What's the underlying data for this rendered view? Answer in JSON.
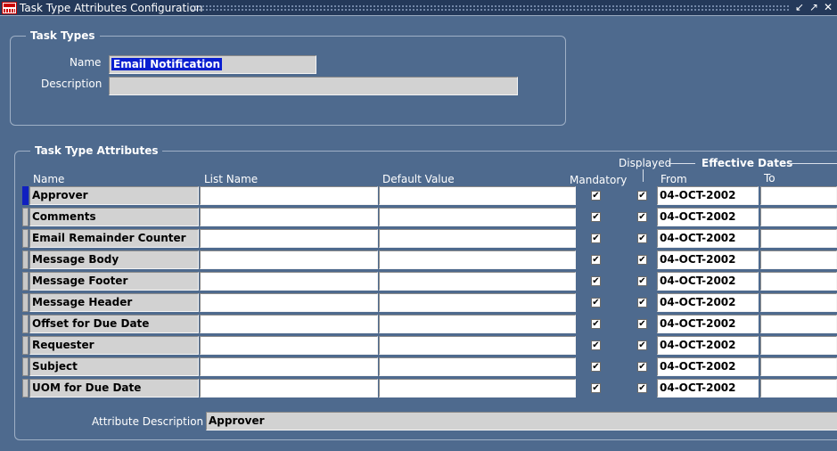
{
  "window": {
    "title": "Task Type Attributes Configuration",
    "buttons": [
      "↙",
      "↗",
      "✕"
    ]
  },
  "task_types": {
    "group_title": "Task Types",
    "name_label": "Name",
    "name_value": "Email Notification",
    "description_label": "Description",
    "description_value": ""
  },
  "attributes": {
    "group_title": "Task Type Attributes",
    "headers": {
      "name": "Name",
      "list_name": "List Name",
      "default_value": "Default Value",
      "mandatory": "Mandatory",
      "displayed": "Displayed",
      "effective_dates": "Effective Dates",
      "from": "From",
      "to": "To"
    },
    "rows": [
      {
        "name": "Approver",
        "list_name": "",
        "default_value": "",
        "mandatory": "✔",
        "displayed": "✔",
        "from": "04-OCT-2002",
        "to": ""
      },
      {
        "name": "Comments",
        "list_name": "",
        "default_value": "",
        "mandatory": "✔",
        "displayed": "✔",
        "from": "04-OCT-2002",
        "to": ""
      },
      {
        "name": "Email Remainder Counter",
        "list_name": "",
        "default_value": "",
        "mandatory": "✔",
        "displayed": "✔",
        "from": "04-OCT-2002",
        "to": ""
      },
      {
        "name": "Message Body",
        "list_name": "",
        "default_value": "",
        "mandatory": "✔",
        "displayed": "✔",
        "from": "04-OCT-2002",
        "to": ""
      },
      {
        "name": "Message Footer",
        "list_name": "",
        "default_value": "",
        "mandatory": "✔",
        "displayed": "✔",
        "from": "04-OCT-2002",
        "to": ""
      },
      {
        "name": "Message Header",
        "list_name": "",
        "default_value": "",
        "mandatory": "✔",
        "displayed": "✔",
        "from": "04-OCT-2002",
        "to": ""
      },
      {
        "name": "Offset for Due Date",
        "list_name": "",
        "default_value": "",
        "mandatory": "✔",
        "displayed": "✔",
        "from": "04-OCT-2002",
        "to": ""
      },
      {
        "name": "Requester",
        "list_name": "",
        "default_value": "",
        "mandatory": "✔",
        "displayed": "✔",
        "from": "04-OCT-2002",
        "to": ""
      },
      {
        "name": "Subject",
        "list_name": "",
        "default_value": "",
        "mandatory": "✔",
        "displayed": "✔",
        "from": "04-OCT-2002",
        "to": ""
      },
      {
        "name": "UOM for Due Date",
        "list_name": "",
        "default_value": "",
        "mandatory": "✔",
        "displayed": "✔",
        "from": "04-OCT-2002",
        "to": ""
      }
    ],
    "attribute_description_label": "Attribute Description",
    "attribute_description_value": "Approver"
  },
  "colors": {
    "background": "#4e6a8e",
    "titlebar": "#24395a",
    "selection": "#0a1fd0"
  }
}
